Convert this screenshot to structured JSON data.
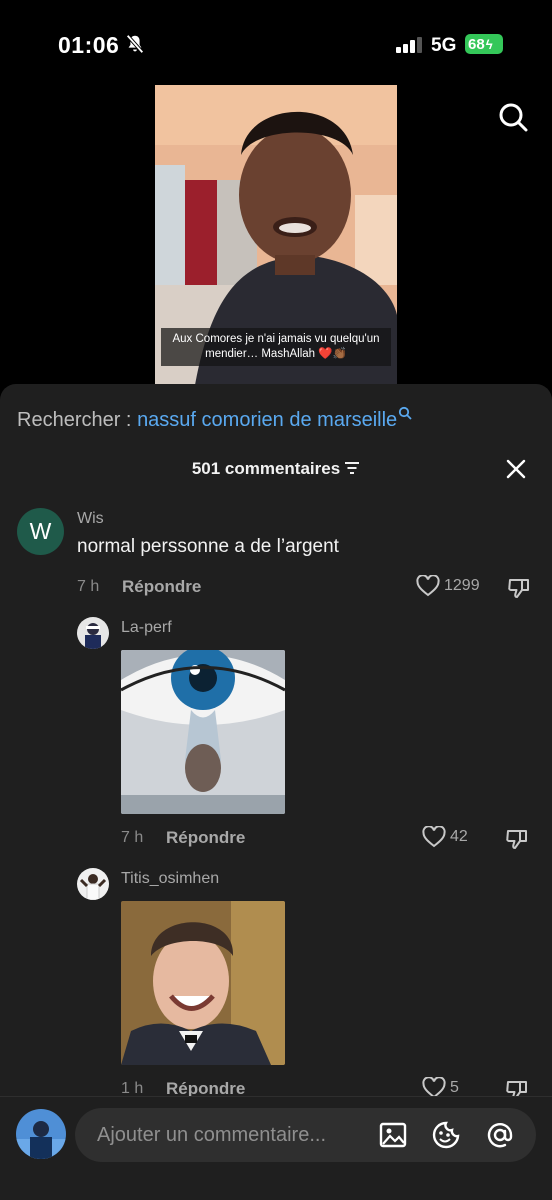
{
  "status": {
    "time": "01:06",
    "network": "5G",
    "battery": "68"
  },
  "video": {
    "caption": "Aux Comores je n'ai jamais vu quelqu'un mendier… MashAllah ❤️👏🏾"
  },
  "search": {
    "prefix": "Rechercher : ",
    "query": "nassuf comorien de marseille"
  },
  "comments_header": {
    "count_label": "501 commentaires"
  },
  "comments": [
    {
      "avatar_letter": "W",
      "user": "Wis",
      "text": "normal perssonne a de l’argent",
      "time": "7 h",
      "reply_label": "Répondre",
      "likes": "1299"
    },
    {
      "user": "La-perf",
      "time": "7 h",
      "reply_label": "Répondre",
      "likes": "42"
    },
    {
      "user": "Titis_osimhen",
      "time": "1 h",
      "reply_label": "Répondre",
      "likes": "5"
    }
  ],
  "composer": {
    "placeholder": "Ajouter un commentaire..."
  },
  "colors": {
    "accent_link": "#5aa9f0",
    "sheet_bg": "#1f1f1f",
    "battery": "#34c759"
  },
  "icons": [
    "bell-slash-icon",
    "signal-icon",
    "search-icon",
    "sort-icon",
    "close-icon",
    "heart-icon",
    "dislike-icon",
    "image-icon",
    "emoji-icon",
    "at-icon"
  ]
}
